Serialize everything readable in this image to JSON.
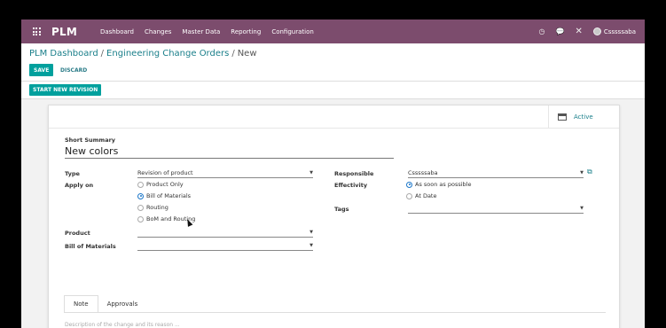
{
  "topbar": {
    "brand": "PLM",
    "menu": [
      "Dashboard",
      "Changes",
      "Master Data",
      "Reporting",
      "Configuration"
    ],
    "user": "Csssssaba"
  },
  "breadcrumb": {
    "items": [
      "PLM Dashboard",
      "Engineering Change Orders"
    ],
    "current": "New"
  },
  "buttons": {
    "save": "SAVE",
    "discard": "DISCARD",
    "start_revision": "START NEW REVISION"
  },
  "status": {
    "active": "Active"
  },
  "form": {
    "summary_label": "Short Summary",
    "summary_value": "New colors",
    "type_label": "Type",
    "type_value": "Revision of product",
    "apply_on_label": "Apply on",
    "apply_on_options": [
      "Product Only",
      "Bill of Materials",
      "Routing",
      "BoM and Routing"
    ],
    "apply_on_selected": "Bill of Materials",
    "product_label": "Product",
    "bom_label": "Bill of Materials",
    "responsible_label": "Responsible",
    "responsible_value": "Csssssaba",
    "effectivity_label": "Effectivity",
    "effectivity_options": [
      "As soon as possible",
      "At Date"
    ],
    "effectivity_selected": "As soon as possible",
    "tags_label": "Tags"
  },
  "tabs": [
    "Note",
    "Approvals"
  ],
  "note_placeholder": "Description of the change and its reason ...",
  "colors": {
    "topbar": "#7c4c6d",
    "primary_button": "#00a09d",
    "link": "#1a7f8a"
  }
}
